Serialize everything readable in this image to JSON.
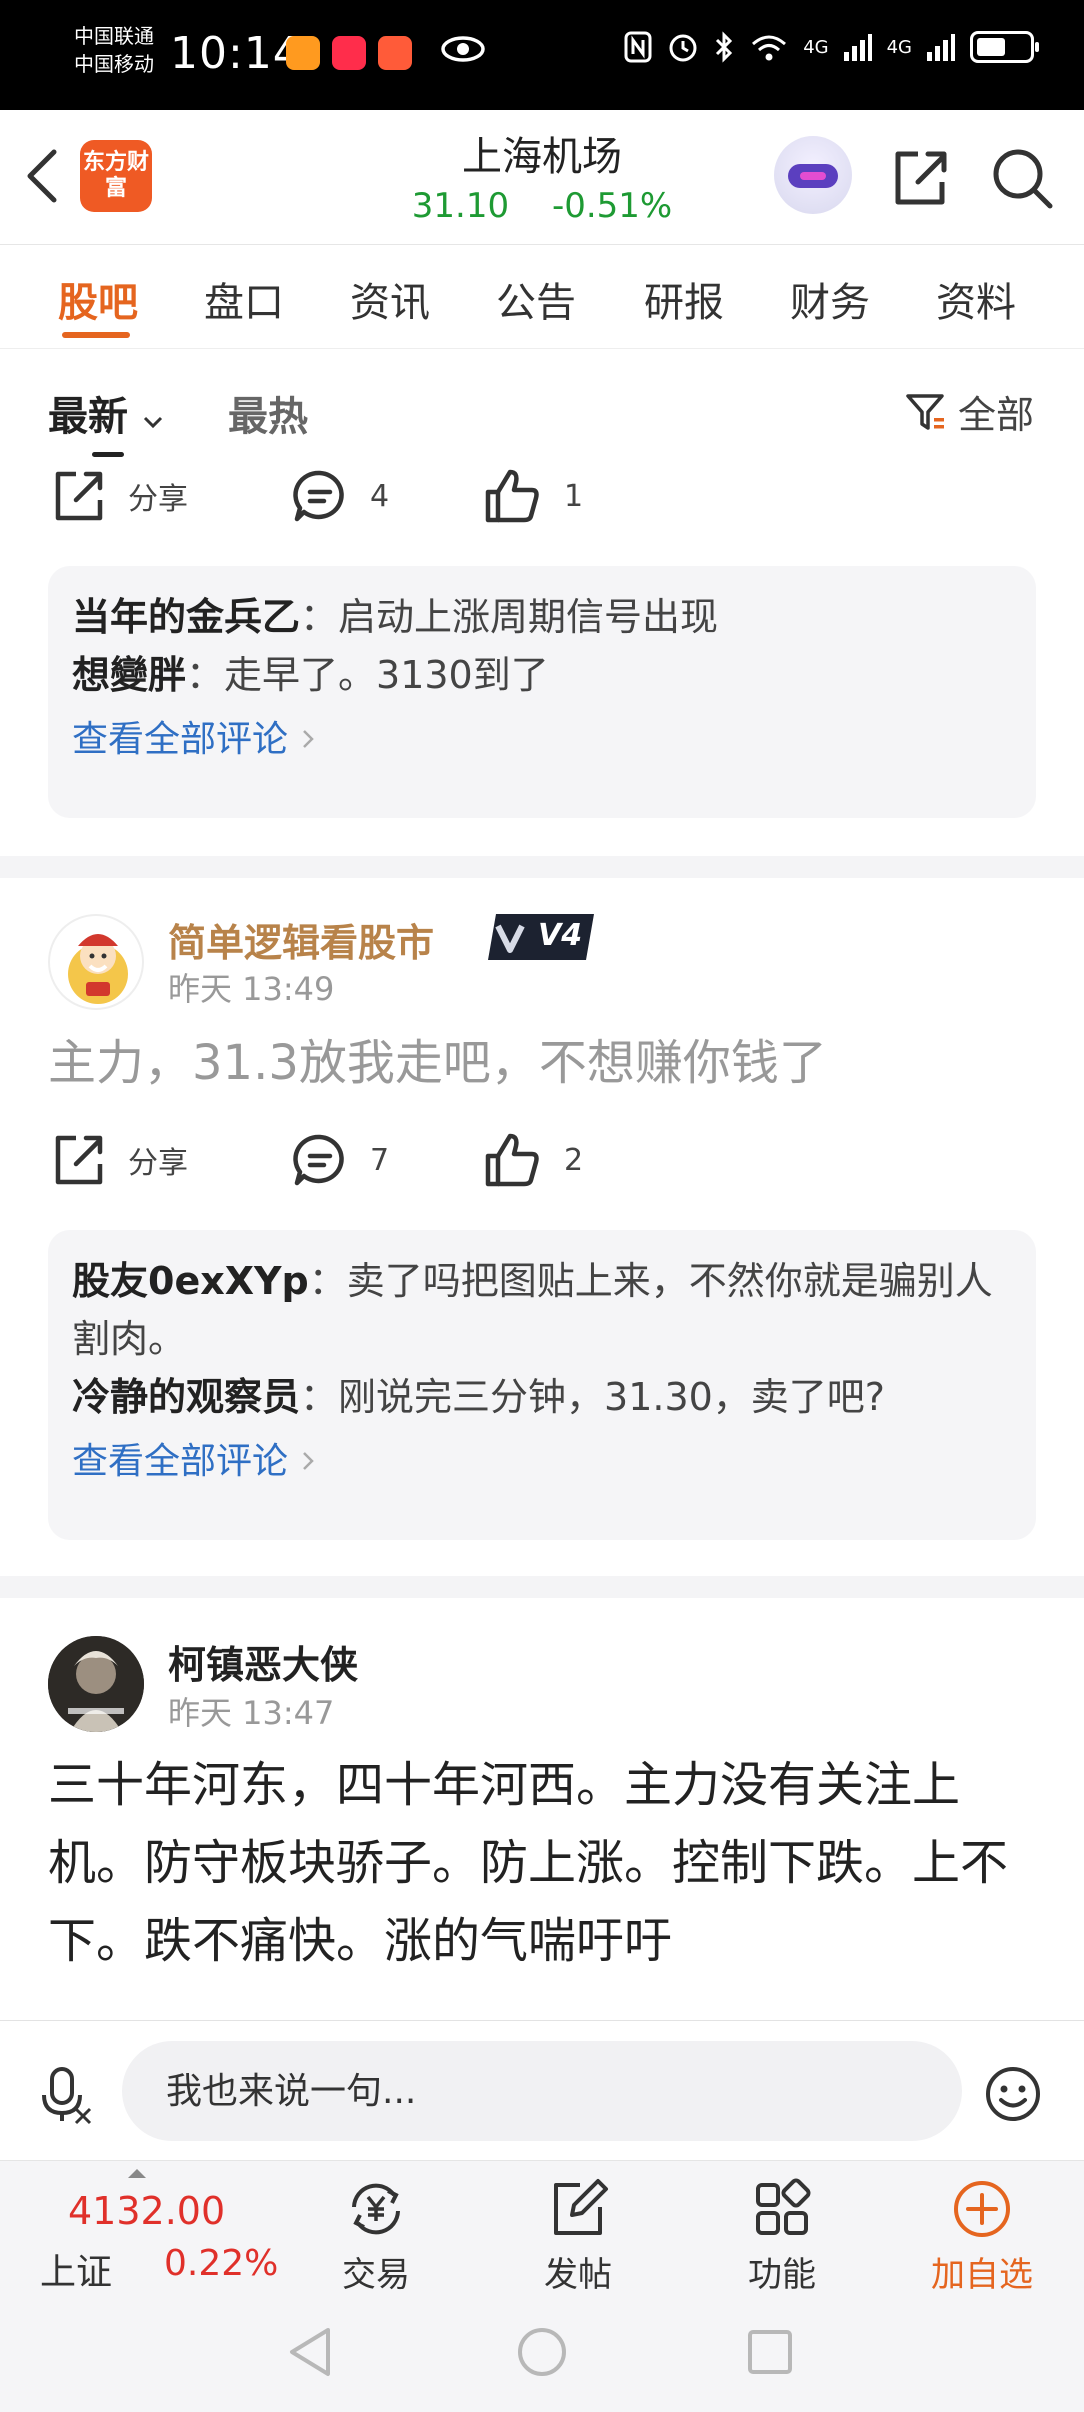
{
  "status_bar": {
    "carrier1": "中国联通",
    "carrier2": "中国移动",
    "time": "10:14",
    "net1": "4G",
    "net2": "4G",
    "wifi_label": "6"
  },
  "header": {
    "logo_text": "东方财富",
    "stock_name": "上海机场",
    "price": "31.10",
    "change": "-0.51%",
    "price_color": "#1e9a33"
  },
  "tabs": [
    "股吧",
    "盘口",
    "资讯",
    "公告",
    "研报",
    "财务",
    "资料"
  ],
  "filter": {
    "latest": "最新",
    "hot": "最热",
    "all": "全部"
  },
  "post1": {
    "share": "分享",
    "comments": "4",
    "likes": "1",
    "replies": [
      {
        "user": "当年的金兵乙",
        "text": "：启动上涨周期信号出现"
      },
      {
        "user": "想變胖",
        "text": "：走早了。3130到了"
      }
    ],
    "view_all": "查看全部评论"
  },
  "post2": {
    "user": "简单逻辑看股市",
    "badge": "V4",
    "time": "昨天 13:49",
    "body": "主力，31.3放我走吧，不想赚你钱了",
    "share": "分享",
    "comments": "7",
    "likes": "2",
    "replies": [
      {
        "user": "股友0exXYp",
        "text": "：卖了吗把图贴上来，不然你就是骗别人割肉。"
      },
      {
        "user": "冷静的观察员",
        "text": "：刚说完三分钟，31.30，卖了吧?"
      }
    ],
    "view_all": "查看全部评论"
  },
  "post3": {
    "user": "柯镇恶大侠",
    "time": "昨天 13:47",
    "body": "三十年河东，四十年河西。主力没有关注上机。防守板块骄子。防上涨。控制下跌。上不下。跌不痛快。涨的气喘吁吁"
  },
  "input": {
    "placeholder": "我也来说一句..."
  },
  "bottom_nav": {
    "index_value": "4132.00",
    "index_name": "上证",
    "index_change": "0.22%",
    "trade": "交易",
    "post": "发帖",
    "functions": "功能",
    "add_watch": "加自选"
  }
}
